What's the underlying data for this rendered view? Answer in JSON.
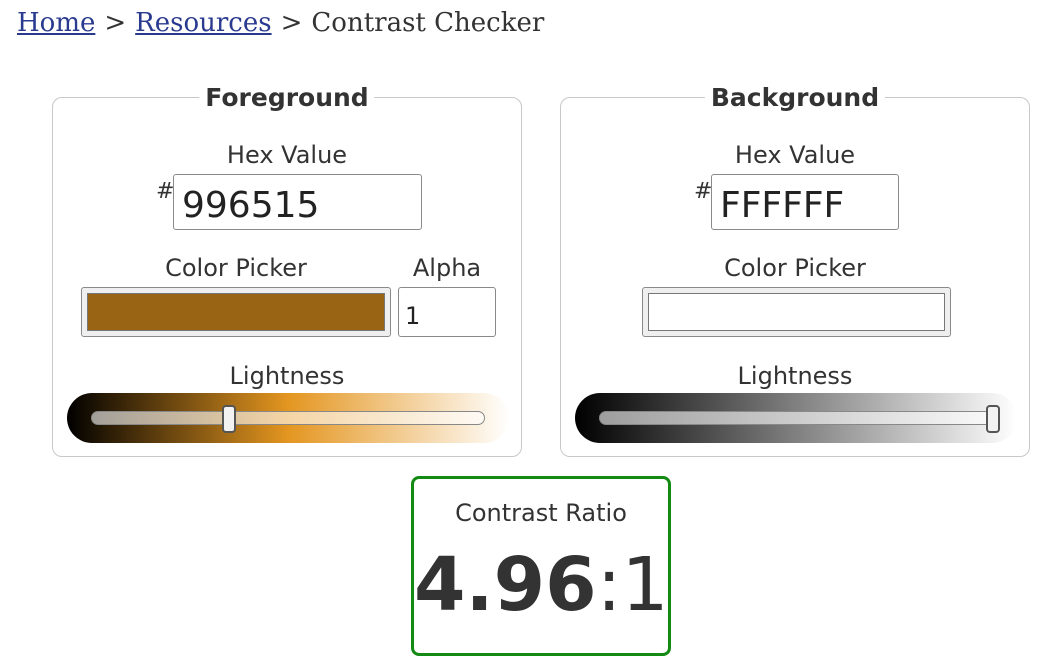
{
  "breadcrumb": {
    "home": "Home",
    "resources": "Resources",
    "separator": ">",
    "current": "Contrast Checker"
  },
  "foreground": {
    "legend": "Foreground",
    "hex_label": "Hex Value",
    "hash": "#",
    "hex_value": "996515",
    "picker_label": "Color Picker",
    "color": "#996515",
    "alpha_label": "Alpha",
    "alpha_value": "1",
    "lightness_label": "Lightness",
    "lightness_fraction": 0.35,
    "slider_gradient": [
      "#000000",
      "#e49620",
      "#ffffff"
    ]
  },
  "background": {
    "legend": "Background",
    "hex_label": "Hex Value",
    "hash": "#",
    "hex_value": "FFFFFF",
    "picker_label": "Color Picker",
    "color": "#FFFFFF",
    "lightness_label": "Lightness",
    "lightness_fraction": 1.0,
    "slider_gradient": [
      "#000000",
      "#808080",
      "#ffffff"
    ]
  },
  "contrast": {
    "label": "Contrast Ratio",
    "value": "4.96",
    "suffix": ":1",
    "pass_color": "#138a13"
  }
}
